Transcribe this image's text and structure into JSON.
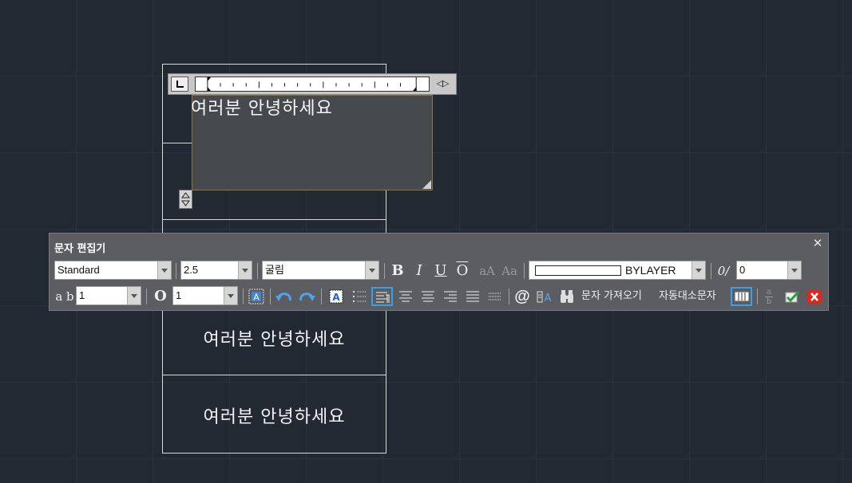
{
  "drawing": {
    "cell_texts": [
      "여러분 안녕하세요",
      "여러분 안녕하세요",
      "여러분 안녕하세요"
    ]
  },
  "editor": {
    "text": "여러분 안녕하세요",
    "ruler_tabs_glyph": "◁▷",
    "height_handle_glyph": "≙"
  },
  "toolbar": {
    "title": "문자 편집기",
    "close_glyph": "✕",
    "style": "Standard",
    "height": "2.5",
    "font": "굴림",
    "bold_label": "B",
    "italic_label": "I",
    "underline_label": "U",
    "overline_label": "O",
    "uppercase_label": "aA",
    "lowercase_label": "Aa",
    "color": "BYLAYER",
    "oblique_glyph": "0/",
    "oblique_angle": "0",
    "tracking_glyph": "a b",
    "tracking": "1",
    "width_glyph": "O",
    "width_factor": "1",
    "at_symbol": "@",
    "import_text_label": "문자 가져오기",
    "autocaps_label": "자동대소문자",
    "stack_label_top": "a",
    "stack_label_bottom": "b"
  },
  "colors": {
    "background": "#222933",
    "panel": "#5b5d60",
    "accent": "#38a0e8",
    "close_red": "#e0261c"
  },
  "icons": [
    "ruler-corner-icon",
    "tab-marker-icon",
    "resize-grip-icon",
    "height-handle-icon",
    "bold-icon",
    "italic-icon",
    "underline-icon",
    "overline-icon",
    "uppercase-icon",
    "lowercase-icon",
    "oblique-icon",
    "tracking-icon",
    "width-icon",
    "mask-icon",
    "undo-icon",
    "redo-icon",
    "text-frame-icon",
    "numbering-icon",
    "align-left-icon",
    "align-center-icon",
    "align-right-icon",
    "justify-icon",
    "distribute-icon",
    "symbol-icon",
    "field-icon",
    "find-icon",
    "column-icon",
    "stack-icon",
    "ok-icon",
    "cancel-icon"
  ]
}
